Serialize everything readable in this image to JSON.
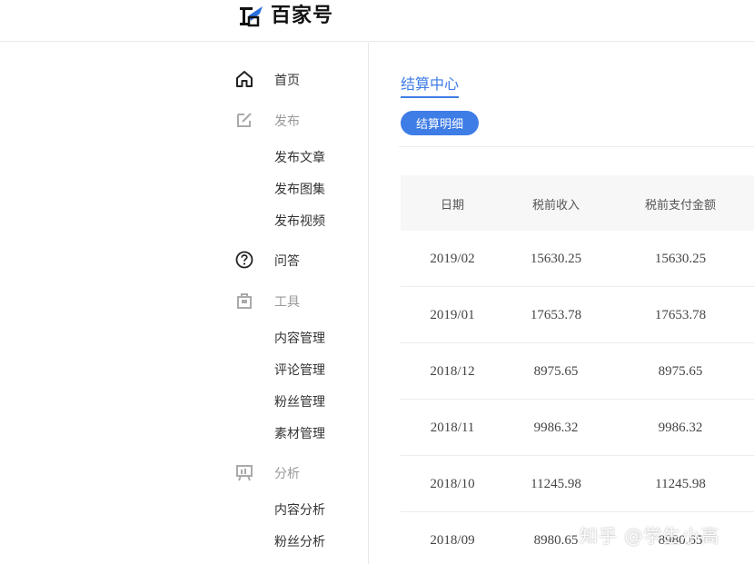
{
  "brand": {
    "name": "百家号"
  },
  "sidebar": {
    "home": {
      "label": "首页"
    },
    "publish": {
      "label": "发布",
      "items": [
        "发布文章",
        "发布图集",
        "发布视频"
      ]
    },
    "qa": {
      "label": "问答"
    },
    "tools": {
      "label": "工具",
      "items": [
        "内容管理",
        "评论管理",
        "粉丝管理",
        "素材管理"
      ]
    },
    "analysis": {
      "label": "分析",
      "items": [
        "内容分析",
        "粉丝分析"
      ]
    }
  },
  "main": {
    "tab": "结算中心",
    "pill": "结算明细",
    "table": {
      "headers": [
        "日期",
        "税前收入",
        "税前支付金额"
      ],
      "rows": [
        [
          "2019/02",
          "15630.25",
          "15630.25"
        ],
        [
          "2019/01",
          "17653.78",
          "17653.78"
        ],
        [
          "2018/12",
          "8975.65",
          "8975.65"
        ],
        [
          "2018/11",
          "9986.32",
          "9986.32"
        ],
        [
          "2018/10",
          "11245.98",
          "11245.98"
        ],
        [
          "2018/09",
          "8980.65",
          "8980.65"
        ]
      ]
    }
  },
  "watermark": "知乎 @学生小高",
  "colors": {
    "accent": "#3e7ce6",
    "header_bg": "#f7f7f7",
    "divider": "#ececec"
  }
}
